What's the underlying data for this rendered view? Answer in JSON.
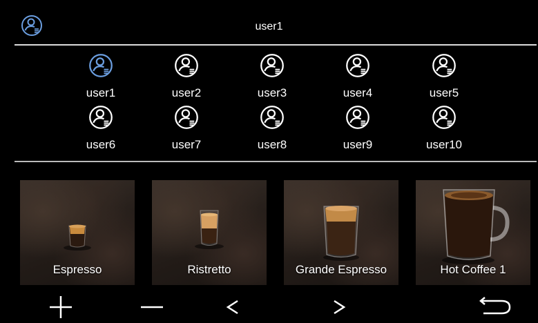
{
  "header": {
    "title": "user1",
    "icon": "user-profile-icon"
  },
  "users": [
    {
      "label": "user1",
      "selected": true
    },
    {
      "label": "user2",
      "selected": false
    },
    {
      "label": "user3",
      "selected": false
    },
    {
      "label": "user4",
      "selected": false
    },
    {
      "label": "user5",
      "selected": false
    },
    {
      "label": "user6",
      "selected": false
    },
    {
      "label": "user7",
      "selected": false
    },
    {
      "label": "user8",
      "selected": false
    },
    {
      "label": "user9",
      "selected": false
    },
    {
      "label": "user10",
      "selected": false
    }
  ],
  "drinks": [
    {
      "label": "Espresso"
    },
    {
      "label": "Ristretto"
    },
    {
      "label": "Grande Espresso"
    },
    {
      "label": "Hot Coffee 1"
    }
  ],
  "nav_icons": [
    "plus-icon",
    "minus-icon",
    "chevron-left-icon",
    "chevron-right-icon",
    "back-arrow-icon"
  ],
  "colors": {
    "accent": "#6b9ee0",
    "icon": "#ffffff",
    "background": "#000000",
    "divider": "#dddddd"
  }
}
